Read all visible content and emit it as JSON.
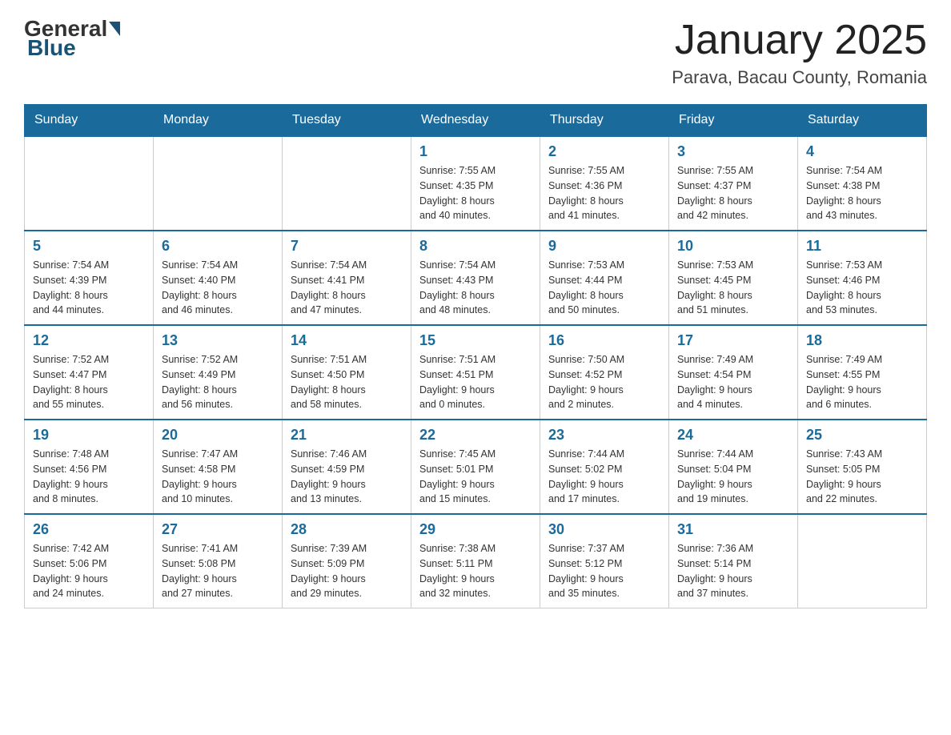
{
  "header": {
    "logo_general": "General",
    "logo_blue": "Blue",
    "month_title": "January 2025",
    "location": "Parava, Bacau County, Romania"
  },
  "days_of_week": [
    "Sunday",
    "Monday",
    "Tuesday",
    "Wednesday",
    "Thursday",
    "Friday",
    "Saturday"
  ],
  "weeks": [
    [
      {
        "day": "",
        "info": ""
      },
      {
        "day": "",
        "info": ""
      },
      {
        "day": "",
        "info": ""
      },
      {
        "day": "1",
        "info": "Sunrise: 7:55 AM\nSunset: 4:35 PM\nDaylight: 8 hours\nand 40 minutes."
      },
      {
        "day": "2",
        "info": "Sunrise: 7:55 AM\nSunset: 4:36 PM\nDaylight: 8 hours\nand 41 minutes."
      },
      {
        "day": "3",
        "info": "Sunrise: 7:55 AM\nSunset: 4:37 PM\nDaylight: 8 hours\nand 42 minutes."
      },
      {
        "day": "4",
        "info": "Sunrise: 7:54 AM\nSunset: 4:38 PM\nDaylight: 8 hours\nand 43 minutes."
      }
    ],
    [
      {
        "day": "5",
        "info": "Sunrise: 7:54 AM\nSunset: 4:39 PM\nDaylight: 8 hours\nand 44 minutes."
      },
      {
        "day": "6",
        "info": "Sunrise: 7:54 AM\nSunset: 4:40 PM\nDaylight: 8 hours\nand 46 minutes."
      },
      {
        "day": "7",
        "info": "Sunrise: 7:54 AM\nSunset: 4:41 PM\nDaylight: 8 hours\nand 47 minutes."
      },
      {
        "day": "8",
        "info": "Sunrise: 7:54 AM\nSunset: 4:43 PM\nDaylight: 8 hours\nand 48 minutes."
      },
      {
        "day": "9",
        "info": "Sunrise: 7:53 AM\nSunset: 4:44 PM\nDaylight: 8 hours\nand 50 minutes."
      },
      {
        "day": "10",
        "info": "Sunrise: 7:53 AM\nSunset: 4:45 PM\nDaylight: 8 hours\nand 51 minutes."
      },
      {
        "day": "11",
        "info": "Sunrise: 7:53 AM\nSunset: 4:46 PM\nDaylight: 8 hours\nand 53 minutes."
      }
    ],
    [
      {
        "day": "12",
        "info": "Sunrise: 7:52 AM\nSunset: 4:47 PM\nDaylight: 8 hours\nand 55 minutes."
      },
      {
        "day": "13",
        "info": "Sunrise: 7:52 AM\nSunset: 4:49 PM\nDaylight: 8 hours\nand 56 minutes."
      },
      {
        "day": "14",
        "info": "Sunrise: 7:51 AM\nSunset: 4:50 PM\nDaylight: 8 hours\nand 58 minutes."
      },
      {
        "day": "15",
        "info": "Sunrise: 7:51 AM\nSunset: 4:51 PM\nDaylight: 9 hours\nand 0 minutes."
      },
      {
        "day": "16",
        "info": "Sunrise: 7:50 AM\nSunset: 4:52 PM\nDaylight: 9 hours\nand 2 minutes."
      },
      {
        "day": "17",
        "info": "Sunrise: 7:49 AM\nSunset: 4:54 PM\nDaylight: 9 hours\nand 4 minutes."
      },
      {
        "day": "18",
        "info": "Sunrise: 7:49 AM\nSunset: 4:55 PM\nDaylight: 9 hours\nand 6 minutes."
      }
    ],
    [
      {
        "day": "19",
        "info": "Sunrise: 7:48 AM\nSunset: 4:56 PM\nDaylight: 9 hours\nand 8 minutes."
      },
      {
        "day": "20",
        "info": "Sunrise: 7:47 AM\nSunset: 4:58 PM\nDaylight: 9 hours\nand 10 minutes."
      },
      {
        "day": "21",
        "info": "Sunrise: 7:46 AM\nSunset: 4:59 PM\nDaylight: 9 hours\nand 13 minutes."
      },
      {
        "day": "22",
        "info": "Sunrise: 7:45 AM\nSunset: 5:01 PM\nDaylight: 9 hours\nand 15 minutes."
      },
      {
        "day": "23",
        "info": "Sunrise: 7:44 AM\nSunset: 5:02 PM\nDaylight: 9 hours\nand 17 minutes."
      },
      {
        "day": "24",
        "info": "Sunrise: 7:44 AM\nSunset: 5:04 PM\nDaylight: 9 hours\nand 19 minutes."
      },
      {
        "day": "25",
        "info": "Sunrise: 7:43 AM\nSunset: 5:05 PM\nDaylight: 9 hours\nand 22 minutes."
      }
    ],
    [
      {
        "day": "26",
        "info": "Sunrise: 7:42 AM\nSunset: 5:06 PM\nDaylight: 9 hours\nand 24 minutes."
      },
      {
        "day": "27",
        "info": "Sunrise: 7:41 AM\nSunset: 5:08 PM\nDaylight: 9 hours\nand 27 minutes."
      },
      {
        "day": "28",
        "info": "Sunrise: 7:39 AM\nSunset: 5:09 PM\nDaylight: 9 hours\nand 29 minutes."
      },
      {
        "day": "29",
        "info": "Sunrise: 7:38 AM\nSunset: 5:11 PM\nDaylight: 9 hours\nand 32 minutes."
      },
      {
        "day": "30",
        "info": "Sunrise: 7:37 AM\nSunset: 5:12 PM\nDaylight: 9 hours\nand 35 minutes."
      },
      {
        "day": "31",
        "info": "Sunrise: 7:36 AM\nSunset: 5:14 PM\nDaylight: 9 hours\nand 37 minutes."
      },
      {
        "day": "",
        "info": ""
      }
    ]
  ]
}
